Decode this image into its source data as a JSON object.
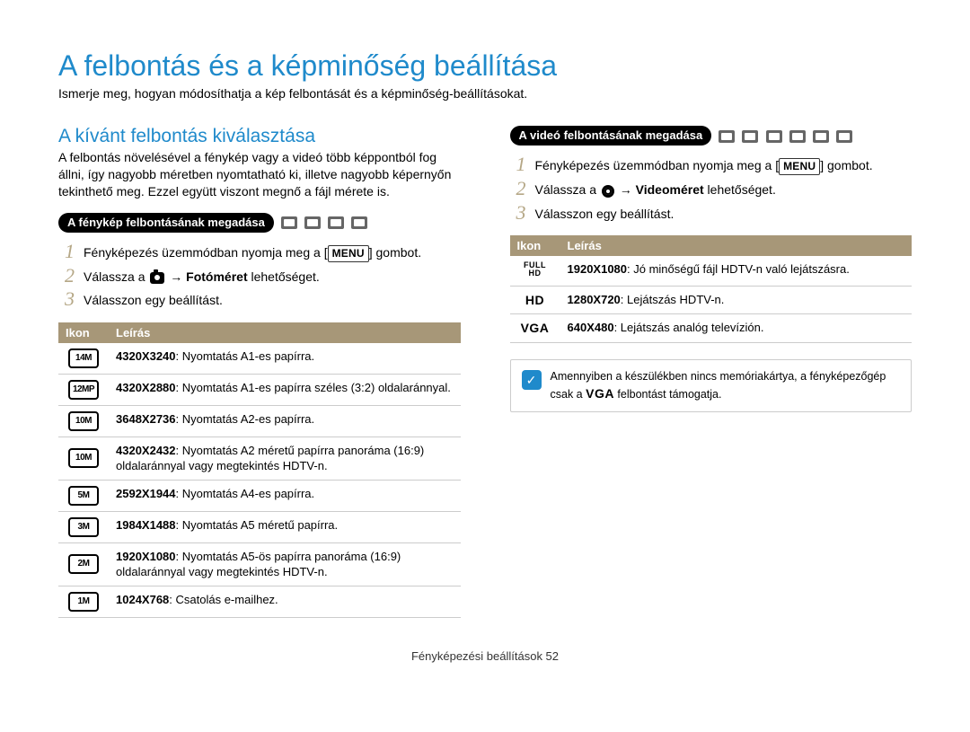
{
  "page": {
    "title": "A felbontás és a képminőség beállítása",
    "intro": "Ismerje meg, hogyan módosíthatja a kép felbontását és a képminőség-beállításokat.",
    "footer": "Fényképezési beállítások  52"
  },
  "left": {
    "section_title": "A kívánt felbontás kiválasztása",
    "body": "A felbontás növelésével a fénykép vagy a videó több képpontból fog állni, így nagyobb méretben nyomtatható ki, illetve nagyobb képernyőn tekinthető meg. Ezzel együtt viszont megnő a fájl mérete is.",
    "pill_photo": "A fénykép felbontásának megadása",
    "steps": {
      "s1_pre": "Fényképezés üzemmódban nyomja meg a [",
      "s1_menu": "MENU",
      "s1_post": "] gombot.",
      "s2_pre": "Válassza a ",
      "s2_arrow": " → ",
      "s2_bold": "Fotóméret",
      "s2_post": " lehetőséget.",
      "s3": "Válasszon egy beállítást."
    },
    "table": {
      "h_icon": "Ikon",
      "h_desc": "Leírás",
      "rows": [
        {
          "icon_label": "14M",
          "res": "4320X3240",
          "desc": ": Nyomtatás A1-es papírra."
        },
        {
          "icon_label": "12MP",
          "res": "4320X2880",
          "desc": ": Nyomtatás A1-es papírra széles (3:2) oldalaránnyal."
        },
        {
          "icon_label": "10M",
          "res": "3648X2736",
          "desc": ": Nyomtatás A2-es papírra."
        },
        {
          "icon_label": "10M",
          "res": "4320X2432",
          "desc": ": Nyomtatás A2 méretű papírra panoráma (16:9) oldalaránnyal vagy megtekintés HDTV-n."
        },
        {
          "icon_label": "5M",
          "res": "2592X1944",
          "desc": ": Nyomtatás A4-es papírra."
        },
        {
          "icon_label": "3M",
          "res": "1984X1488",
          "desc": ": Nyomtatás A5 méretű papírra."
        },
        {
          "icon_label": "2M",
          "res": "1920X1080",
          "desc": ": Nyomtatás A5-ös papírra panoráma (16:9) oldalaránnyal vagy megtekintés HDTV-n."
        },
        {
          "icon_label": "1M",
          "res": "1024X768",
          "desc": ": Csatolás e-mailhez."
        }
      ]
    }
  },
  "right": {
    "pill_video": "A videó felbontásának megadása",
    "steps": {
      "s1_pre": "Fényképezés üzemmódban nyomja meg a [",
      "s1_menu": "MENU",
      "s1_post": "] gombot.",
      "s2_pre": "Válassza a ",
      "s2_arrow": " → ",
      "s2_bold": "Videoméret",
      "s2_post": " lehetőséget.",
      "s3": "Válasszon egy beállítást."
    },
    "table": {
      "h_icon": "Ikon",
      "h_desc": "Leírás",
      "rows": [
        {
          "icon_text": "FULL HD",
          "res": "1920X1080",
          "desc": ": Jó minőségű fájl HDTV-n való lejátszásra."
        },
        {
          "icon_text": "HD",
          "res": "1280X720",
          "desc": ": Lejátszás HDTV-n."
        },
        {
          "icon_text": "VGA",
          "res": "640X480",
          "desc": ": Lejátszás analóg televízión."
        }
      ]
    },
    "note_pre": "Amennyiben a készülékben nincs memóriakártya, a fényképezőgép csak a ",
    "note_vga": "VGA",
    "note_post": " felbontást támogatja."
  }
}
